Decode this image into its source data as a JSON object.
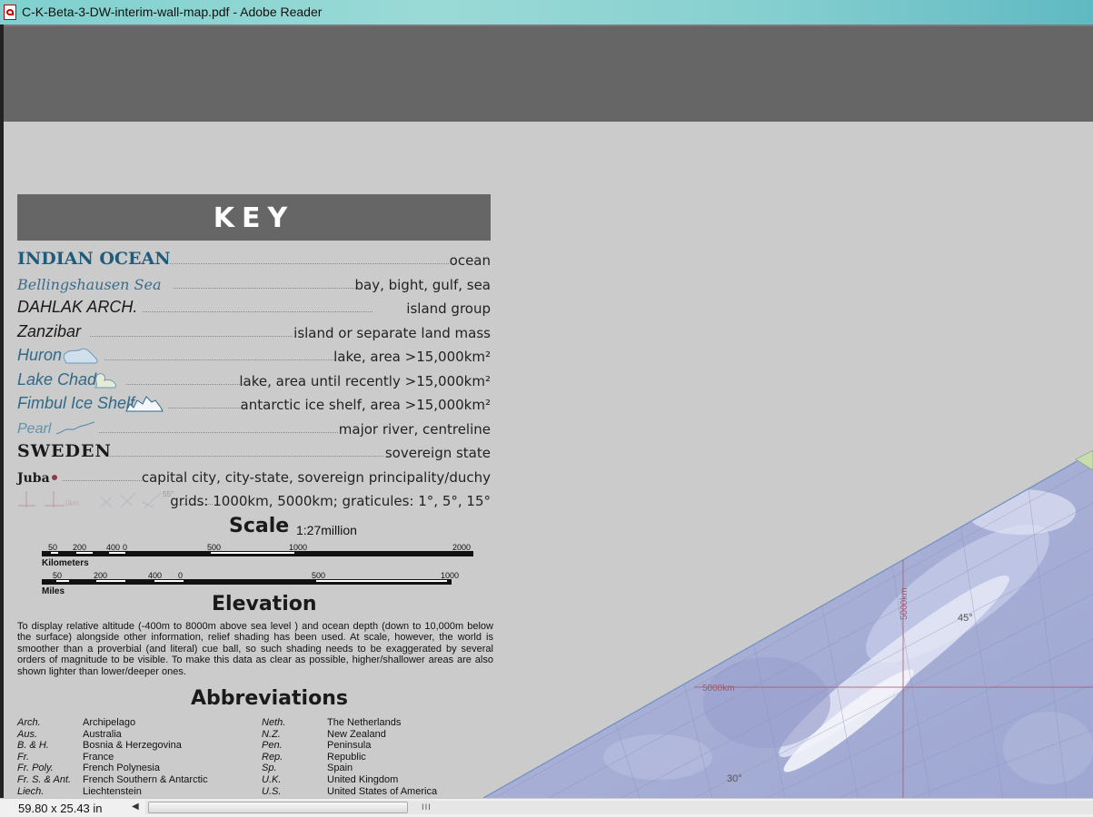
{
  "window": {
    "title": "C-K-Beta-3-DW-interim-wall-map.pdf - Adobe Reader",
    "icon": "pdf-file-icon"
  },
  "key": {
    "heading": "KEY",
    "rows": [
      {
        "label": "INDIAN OCEAN",
        "desc": "ocean",
        "color": "#1f5b7a"
      },
      {
        "label": "Bellingshausen Sea",
        "desc": "bay, bight, gulf, sea",
        "color": "#3b6b88"
      },
      {
        "label": "DAHLAK ARCH.",
        "desc": "island group",
        "color": "#1a1a1a"
      },
      {
        "label": "Zanzibar",
        "desc": "island or separate land mass",
        "color": "#1a1a1a"
      },
      {
        "label": "Huron",
        "desc": "lake, area >15,000km²",
        "color": "#2f6a88",
        "icon": "lake-shape-icon"
      },
      {
        "label": "Lake Chad",
        "desc": "lake, area until recently >15,000km²",
        "color": "#2f6a88",
        "icon": "dry-lake-shape-icon"
      },
      {
        "label": "Fimbul Ice Shelf",
        "desc": "antarctic ice shelf, area >15,000km²",
        "color": "#2f6a88",
        "icon": "ice-shelf-shape-icon"
      },
      {
        "label": "Pearl",
        "desc": "major river, centreline",
        "color": "#5f92ad",
        "icon": "river-line-icon"
      },
      {
        "label": "SWEDEN",
        "desc": "sovereign state",
        "color": "#1a1a1a"
      },
      {
        "label": "Juba",
        "desc": "capital city, city-state, sovereign principality/duchy",
        "color": "#1a1a1a",
        "icon": "capital-dot-icon"
      },
      {
        "label": "",
        "desc": "grids: 1000km, 5000km; graticules: 1°, 5°, 15°",
        "icon": "grid-graticule-icon",
        "grid_text": [
          "0km",
          "55°"
        ]
      }
    ]
  },
  "scale": {
    "heading": "Scale",
    "ratio": "1:27million",
    "km_label": "Kilometers",
    "km_ticks": [
      "50",
      "200",
      "400",
      "0",
      "500",
      "1000",
      "2000"
    ],
    "miles_label": "Miles",
    "mi_ticks": [
      "50",
      "200",
      "400",
      "0",
      "500",
      "1000"
    ]
  },
  "elevation": {
    "heading": "Elevation",
    "text": "To display relative altitude (-400m to 8000m above sea level ) and ocean depth (down to 10,000m below the surface) alongside other information, relief shading has been used. At scale, however, the world is smoother than a proverbial (and literal) cue ball, so such shading needs to be exaggerated by several orders of magnitude to be visible. To make this data as clear as possible, higher/shallower areas are also shown lighter than lower/deeper ones."
  },
  "abbreviations": {
    "heading": "Abbreviations",
    "left": [
      {
        "abbr": "Arch.",
        "full": "Archipelago"
      },
      {
        "abbr": "Aus.",
        "full": "Australia"
      },
      {
        "abbr": "B. & H.",
        "full": "Bosnia & Herzegovina"
      },
      {
        "abbr": "Fr.",
        "full": "France"
      },
      {
        "abbr": "Fr. Poly.",
        "full": "French Polynesia"
      },
      {
        "abbr": "Fr. S. & Ant.",
        "full": "French Southern & Antarctic"
      },
      {
        "abbr": "Liech.",
        "full": "Liechtenstein"
      }
    ],
    "right": [
      {
        "abbr": "Neth.",
        "full": "The Netherlands"
      },
      {
        "abbr": "N.Z.",
        "full": "New Zealand"
      },
      {
        "abbr": "Pen.",
        "full": "Peninsula"
      },
      {
        "abbr": "Rep.",
        "full": "Republic"
      },
      {
        "abbr": "Sp.",
        "full": "Spain"
      },
      {
        "abbr": "U.K.",
        "full": "United Kingdom"
      },
      {
        "abbr": "U.S.",
        "full": "United States of America"
      }
    ]
  },
  "map": {
    "labels": {
      "grid_5000_vertical": "5000km",
      "grid_5000_horizontal": "5000km",
      "lat_45": "45°",
      "lat_30": "30°"
    },
    "ocean_color": "#a9b1d6",
    "grid_color": "#a05a6a"
  },
  "status": {
    "page_size": "59.80 x 25.43 in",
    "scroll_grip": "III"
  }
}
